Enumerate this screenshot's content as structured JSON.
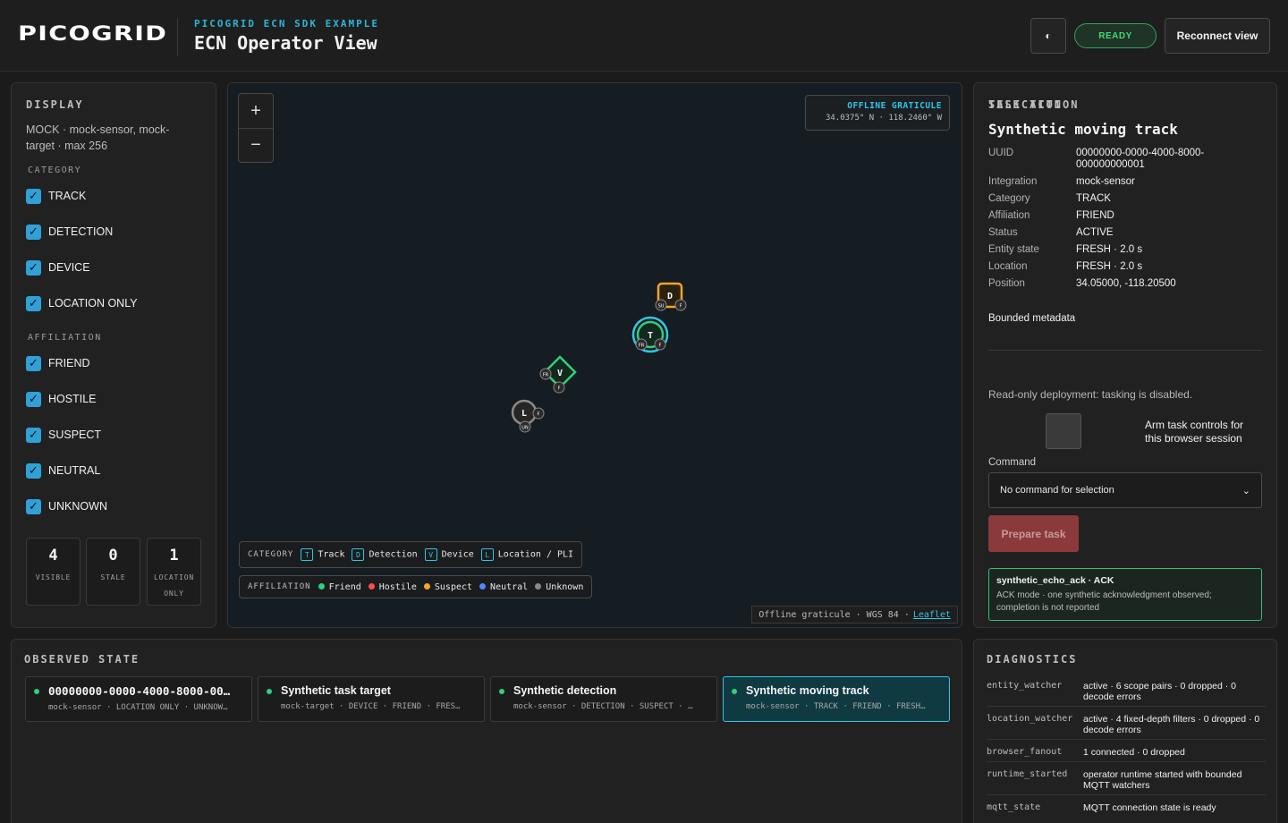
{
  "header": {
    "logo": "PICOGRID",
    "subtitle": "PICOGRID ECN SDK EXAMPLE",
    "title": "ECN Operator View",
    "status": "READY",
    "reconnect_label": "Reconnect view"
  },
  "display": {
    "title": "DISPLAY",
    "summary": "MOCK · mock-sensor, mock-target · max 256",
    "category_label": "CATEGORY",
    "categories": [
      "TRACK",
      "DETECTION",
      "DEVICE",
      "LOCATION ONLY"
    ],
    "affiliation_label": "AFFILIATION",
    "affiliations": [
      "FRIEND",
      "HOSTILE",
      "SUSPECT",
      "NEUTRAL",
      "UNKNOWN"
    ],
    "stats": [
      {
        "value": "4",
        "label": "VISIBLE"
      },
      {
        "value": "0",
        "label": "STALE"
      },
      {
        "value": "1",
        "label": "LOCATION ONLY"
      }
    ]
  },
  "map": {
    "zoom_in": "+",
    "zoom_out": "−",
    "graticule_title": "OFFLINE GRATICULE",
    "graticule_coords": "34.0375° N · 118.2460° W",
    "legend_category_label": "CATEGORY",
    "legend_categories": [
      {
        "code": "T",
        "label": "Track"
      },
      {
        "code": "D",
        "label": "Detection"
      },
      {
        "code": "V",
        "label": "Device"
      },
      {
        "code": "L",
        "label": "Location / PLI"
      }
    ],
    "legend_affiliation_label": "AFFILIATION",
    "legend_affiliations": [
      {
        "label": "Friend",
        "color": "#2fd07a"
      },
      {
        "label": "Hostile",
        "color": "#ff4d4d"
      },
      {
        "label": "Suspect",
        "color": "#f5a623"
      },
      {
        "label": "Neutral",
        "color": "#4a8cff"
      },
      {
        "label": "Unknown",
        "color": "#8a8a8a"
      }
    ],
    "attribution_text": "Offline graticule · WGS 84 ·",
    "attribution_link": "Leaflet",
    "markers": [
      {
        "code": "D",
        "tags": [
          "SU",
          "F"
        ]
      },
      {
        "code": "T",
        "tags": [
          "FR",
          "F"
        ]
      },
      {
        "code": "V",
        "tags": [
          "FR",
          "F"
        ]
      },
      {
        "code": "L",
        "tags": [
          "UN",
          "F"
        ]
      }
    ]
  },
  "selection": {
    "title": "SELECTION",
    "name": "Synthetic moving track",
    "fields": [
      {
        "k": "UUID",
        "v": "00000000-0000-4000-8000-000000000001"
      },
      {
        "k": "Integration",
        "v": "mock-sensor"
      },
      {
        "k": "Category",
        "v": "TRACK"
      },
      {
        "k": "Affiliation",
        "v": "FRIEND"
      },
      {
        "k": "Status",
        "v": "ACTIVE"
      },
      {
        "k": "Entity state",
        "v": "FRESH · 2.0 s"
      },
      {
        "k": "Location",
        "v": "FRESH · 2.0 s"
      },
      {
        "k": "Position",
        "v": "34.05000, -118.20500"
      }
    ],
    "bounded_metadata": "Bounded metadata",
    "task_title": "TASK ACTION",
    "task_note": "Read-only deployment: tasking is disabled.",
    "arm_label": "Arm task controls for this browser session",
    "command_label": "Command",
    "command_value": "No command for selection",
    "prepare_label": "Prepare task",
    "ack_title": "synthetic_echo_ack · ACK",
    "ack_body": "ACK mode · one synthetic acknowledgment observed; completion is not reported"
  },
  "observed": {
    "title": "OBSERVED STATE",
    "cards": [
      {
        "name": "00000000-0000-4000-8000-00…",
        "meta": "mock-sensor · LOCATION ONLY · UNKNOW…"
      },
      {
        "name": "Synthetic task target",
        "meta": "mock-target · DEVICE · FRIEND · FRES…"
      },
      {
        "name": "Synthetic detection",
        "meta": "mock-sensor · DETECTION · SUSPECT · …"
      },
      {
        "name": "Synthetic moving track",
        "meta": "mock-sensor · TRACK · FRIEND · FRESH…"
      }
    ]
  },
  "diagnostics": {
    "title": "DIAGNOSTICS",
    "rows": [
      {
        "k": "entity_watcher",
        "v": "active · 6 scope pairs · 0 dropped · 0 decode errors"
      },
      {
        "k": "location_watcher",
        "v": "active · 4 fixed-depth filters · 0 dropped · 0 decode errors"
      },
      {
        "k": "browser_fanout",
        "v": "1 connected · 0 dropped"
      },
      {
        "k": "runtime_started",
        "v": "operator runtime started with bounded MQTT watchers"
      },
      {
        "k": "mqtt_state",
        "v": "MQTT connection state is ready"
      }
    ]
  }
}
